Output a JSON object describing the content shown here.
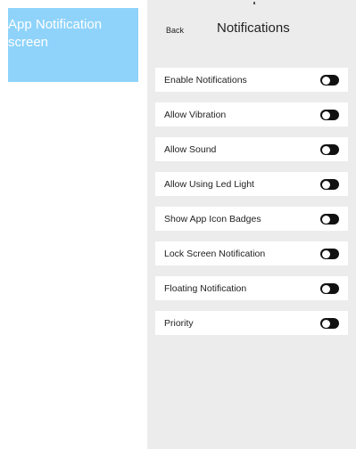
{
  "screen_label": {
    "line1": "App Notification",
    "line2": "screen"
  },
  "header": {
    "back_label": "Back",
    "title": "Notifications"
  },
  "settings": [
    {
      "label": "Enable Notifications",
      "enabled": false
    },
    {
      "label": "Allow Vibration",
      "enabled": false
    },
    {
      "label": "Allow Sound",
      "enabled": false
    },
    {
      "label": "Allow Using Led Light",
      "enabled": false
    },
    {
      "label": "Show App Icon Badges",
      "enabled": false
    },
    {
      "label": "Lock Screen Notification",
      "enabled": false
    },
    {
      "label": "Floating Notification",
      "enabled": false
    },
    {
      "label": "Priority",
      "enabled": false
    }
  ],
  "colors": {
    "label_bg": "#8fd3fb",
    "phone_bg": "#ececec",
    "toggle_off": "#111111"
  }
}
